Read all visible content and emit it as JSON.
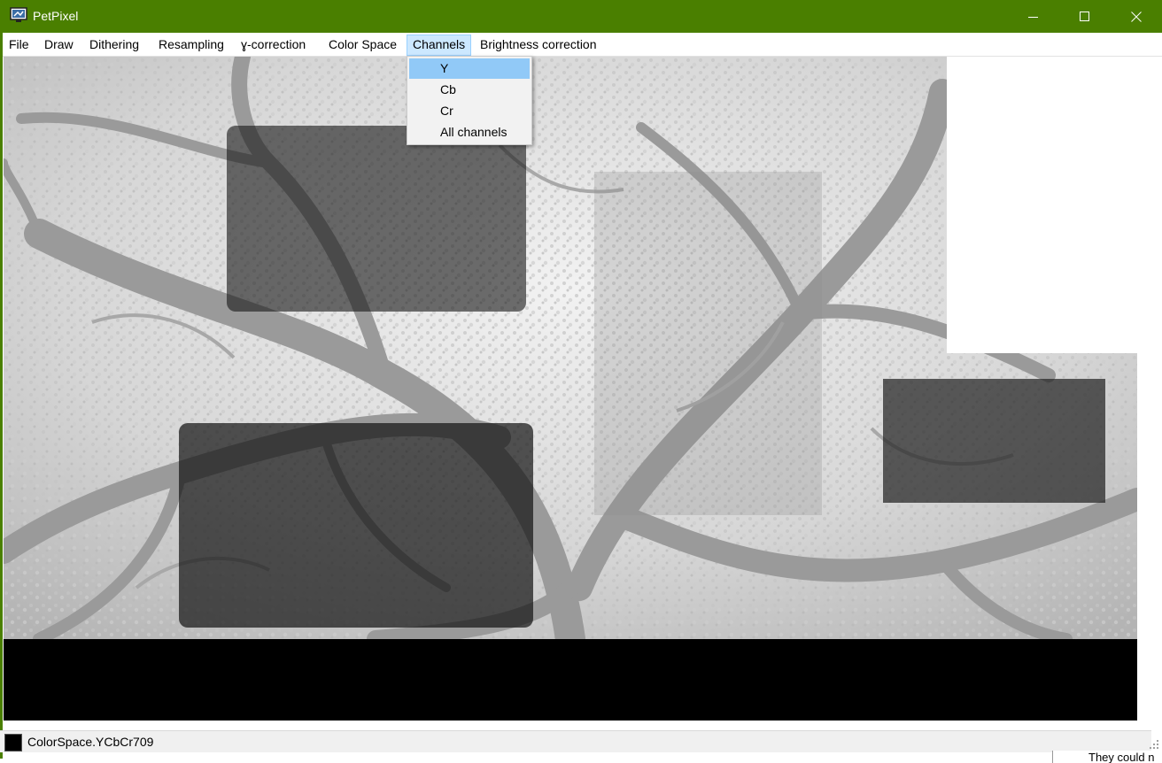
{
  "window": {
    "title": "PetPixel",
    "titlebar_color": "#4a7f00",
    "controls": [
      "minimize-icon",
      "maximize-icon",
      "close-icon"
    ]
  },
  "menubar": {
    "items": [
      {
        "label": "File"
      },
      {
        "label": "Draw"
      },
      {
        "label": "Dithering"
      },
      {
        "label": "Resampling"
      },
      {
        "label": "ɣ-correction"
      },
      {
        "label": "Color Space"
      },
      {
        "label": "Channels",
        "active": true
      },
      {
        "label": "Brightness correction"
      }
    ]
  },
  "channels_menu": {
    "items": [
      {
        "label": "Y",
        "highlighted": true
      },
      {
        "label": "Cb"
      },
      {
        "label": "Cr"
      },
      {
        "label": "All channels"
      }
    ]
  },
  "statusbar": {
    "current_color": "#000000",
    "text": "ColorSpace.YCbCr709"
  },
  "background_window": {
    "text": "They could n"
  }
}
